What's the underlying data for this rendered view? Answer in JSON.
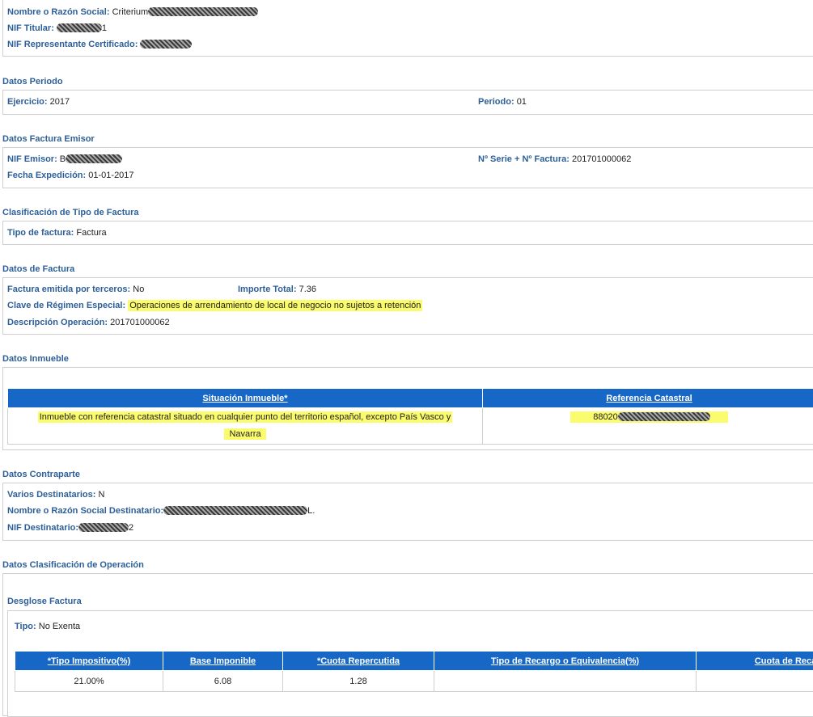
{
  "titular": {
    "nombre_label": "Nombre o Razón Social:",
    "nombre_value": "Criterium",
    "nif_label": "NIF Titular:",
    "nif_suffix": "1",
    "rep_label": "NIF Representante Certificado:"
  },
  "periodo": {
    "title": "Datos Periodo",
    "ejercicio_label": "Ejercicio:",
    "ejercicio_value": "2017",
    "periodo_label": "Periodo:",
    "periodo_value": "01"
  },
  "emisor": {
    "title": "Datos Factura Emisor",
    "nif_label": "NIF Emisor:",
    "nif_prefix": "B",
    "serie_label": "Nº Serie + Nº Factura:",
    "serie_value": "201701000062",
    "fecha_label": "Fecha Expedición:",
    "fecha_value": "01-01-2017"
  },
  "clasificacion": {
    "title": "Clasificación de Tipo de Factura",
    "tipo_label": "Tipo de factura:",
    "tipo_value": "Factura"
  },
  "factura": {
    "title": "Datos de Factura",
    "terceros_label": "Factura emitida por terceros:",
    "terceros_value": "No",
    "importe_label": "Importe Total:",
    "importe_value": "7.36",
    "clave_label": "Clave de Régimen Especial:",
    "clave_value": "Operaciones de arrendamiento de local de negocio no sujetos a retención",
    "desc_label": "Descripción Operación:",
    "desc_value": "201701000062"
  },
  "inmueble": {
    "title": "Datos Inmueble",
    "col1": "Situación Inmueble*",
    "col2": "Referencia Catastral",
    "situacion_line1": "Inmueble con referencia catastral situado en cualquier punto del territorio español, excepto País Vasco y",
    "situacion_line2": "Navarra",
    "referencia_prefix": "88020"
  },
  "contraparte": {
    "title": "Datos Contraparte",
    "varios_label": "Varios Destinatarios:",
    "varios_value": "N",
    "nombre_label": "Nombre o Razón Social Destinatario:",
    "nombre_suffix": "L.",
    "nif_label": "NIF Destinatario:",
    "nif_suffix": "2"
  },
  "operacion": {
    "title": "Datos Clasificación de Operación",
    "desglose_title": "Desglose Factura",
    "tipo_label": "Tipo:",
    "tipo_value": "No Exenta",
    "columns": [
      "*Tipo Impositivo(%)",
      "Base Imponible",
      "*Cuota Repercutida",
      "Tipo de Recargo o Equivalencia(%)",
      "Cuota de Recargo"
    ],
    "row": [
      "21.00%",
      "6.08",
      "1.28",
      "",
      ""
    ]
  },
  "colors": {
    "label": "#2d5f98",
    "header_bg": "#1767c6",
    "highlight": "#fbfb6e"
  }
}
